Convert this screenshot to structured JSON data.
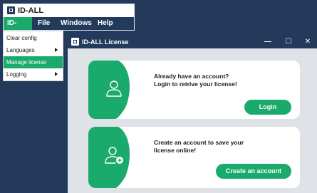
{
  "main_window": {
    "title": "ID-ALL",
    "menu": [
      "ID-ALL",
      "File",
      "Windows",
      "Help"
    ]
  },
  "dropdown": {
    "items": [
      {
        "label": "Clear config",
        "submenu": false,
        "active": false
      },
      {
        "label": "Languages",
        "submenu": true,
        "active": false
      },
      {
        "label": "Manage license",
        "submenu": false,
        "active": true
      },
      {
        "label": "Logging",
        "submenu": true,
        "active": false
      }
    ]
  },
  "license_window": {
    "title": "ID-ALL License",
    "controls": {
      "minimize": "—",
      "maximize": "☐",
      "close": "✕"
    },
    "login_card": {
      "line1": "Already have an account?",
      "line2": "Login to retrive your license!",
      "button": "Login",
      "icon": "user-icon"
    },
    "create_card": {
      "line1": "Create an account to save your",
      "line2": "license online!",
      "button": "Create an account",
      "icon": "add-user-icon"
    }
  },
  "colors": {
    "accent": "#1aaa6c",
    "navy": "#243a5a",
    "panel_bg": "#dfe3e8"
  }
}
